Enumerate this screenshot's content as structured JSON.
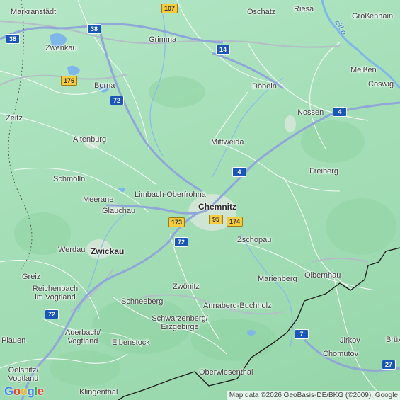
{
  "places": [
    {
      "key": "markranstaedt",
      "name": "Markranstädt"
    },
    {
      "key": "oschatz",
      "name": "Oschatz"
    },
    {
      "key": "riesa",
      "name": "Riesa"
    },
    {
      "key": "grossenhain",
      "name": "Großenhain"
    },
    {
      "key": "zwenkau",
      "name": "Zwenkau"
    },
    {
      "key": "grimma",
      "name": "Grimma"
    },
    {
      "key": "borna",
      "name": "Borna"
    },
    {
      "key": "meissen",
      "name": "Meißen"
    },
    {
      "key": "coswig",
      "name": "Coswig"
    },
    {
      "key": "doebeln",
      "name": "Döbeln"
    },
    {
      "key": "zeitz",
      "name": "Zeitz"
    },
    {
      "key": "nossen",
      "name": "Nossen"
    },
    {
      "key": "altenburg",
      "name": "Altenburg"
    },
    {
      "key": "mittweida",
      "name": "Mittweida"
    },
    {
      "key": "freiberg",
      "name": "Freiberg"
    },
    {
      "key": "schmoelln",
      "name": "Schmölln"
    },
    {
      "key": "limbach",
      "name": "Limbach-Oberfrohna"
    },
    {
      "key": "meerane",
      "name": "Meerane"
    },
    {
      "key": "chemnitz",
      "name": "Chemnitz"
    },
    {
      "key": "glauchau",
      "name": "Glauchau"
    },
    {
      "key": "zschopau",
      "name": "Zschopau"
    },
    {
      "key": "werdau",
      "name": "Werdau"
    },
    {
      "key": "zwickau",
      "name": "Zwickau"
    },
    {
      "key": "greiz",
      "name": "Greiz"
    },
    {
      "key": "marienberg",
      "name": "Marienberg"
    },
    {
      "key": "olbernhau",
      "name": "Olbernhau"
    },
    {
      "key": "reichenbach",
      "name": "Reichenbach im Vogtland"
    },
    {
      "key": "zwoenitz",
      "name": "Zwönitz"
    },
    {
      "key": "schneeberg",
      "name": "Schneeberg"
    },
    {
      "key": "annaberg",
      "name": "Annaberg-Buchholz"
    },
    {
      "key": "schwarzenberg",
      "name": "Schwarzenberg/ Erzgebirge"
    },
    {
      "key": "auerbach",
      "name": "Auerbach/ Vogtland"
    },
    {
      "key": "jirkov",
      "name": "Jirkov"
    },
    {
      "key": "plauen",
      "name": "Plauen"
    },
    {
      "key": "eibenstock",
      "name": "Eibenstock"
    },
    {
      "key": "brux",
      "name": "Brüx"
    },
    {
      "key": "chomutov",
      "name": "Chomutov"
    },
    {
      "key": "oelsnitz",
      "name": "Oelsnitz/ Vogtland"
    },
    {
      "key": "oberwiesenthal",
      "name": "Oberwiesenthal"
    },
    {
      "key": "klingenthal",
      "name": "Klingenthal"
    }
  ],
  "river": "Elbe",
  "shields": {
    "b107": "107",
    "a38a": "38",
    "a38b": "38",
    "a14": "14",
    "b176": "176",
    "a72a": "72",
    "a4a": "4",
    "a4b": "4",
    "b95": "95",
    "b173": "173",
    "b174": "174",
    "a72b": "72",
    "a72c": "72",
    "a7": "7",
    "a27": "27"
  },
  "logo": {
    "g1": "G",
    "o1": "o",
    "o2": "o",
    "g2": "g",
    "l": "l",
    "e": "e"
  },
  "attribution": "Map data ©2026 GeoBasis-DE/BKG (©2009), Google",
  "colors": {
    "motorway": "#1a55b8",
    "federal_road": "#f6cc3f",
    "road": "#ffffff",
    "water": "#7fb8e8",
    "border": "#1f1f1f"
  }
}
